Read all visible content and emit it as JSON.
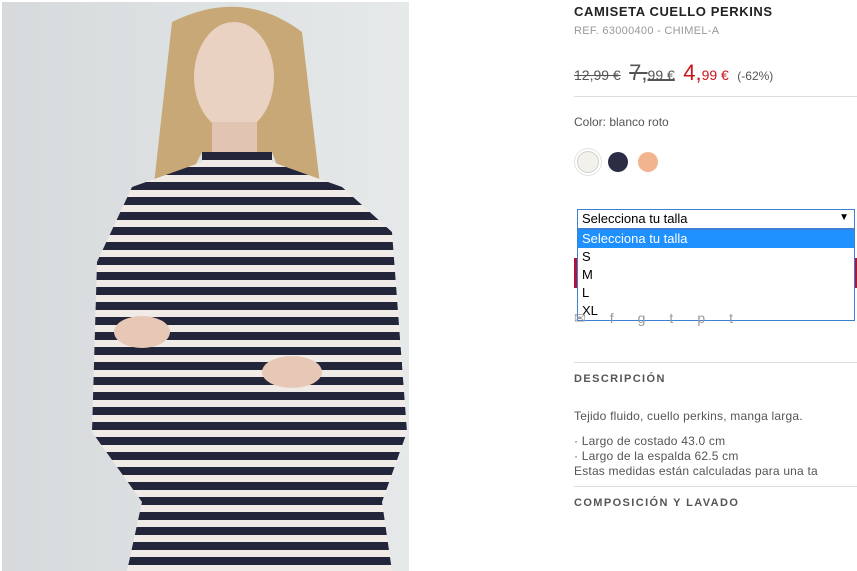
{
  "product": {
    "name": "CAMISETA CUELLO PERKINS",
    "ref": "REF. 63000400 - CHIMEL-A",
    "price_original": "12,99 €",
    "price_previous_int": "7,",
    "price_previous_dec": "99 €",
    "price_current_int": "4,",
    "price_current_dec": "99 €",
    "discount": "(-62%)",
    "color_label": "Color: blanco roto",
    "swatches": [
      {
        "name": "blanco roto",
        "hex": "#f3f1ec"
      },
      {
        "name": "marino",
        "hex": "#2b2d45"
      },
      {
        "name": "melocoton",
        "hex": "#f2b48e"
      }
    ]
  },
  "size_select": {
    "selected": "Selecciona tu talla",
    "options": [
      "Selecciona tu talla",
      "S",
      "M",
      "L",
      "XL"
    ],
    "arrow": "▼"
  },
  "share_icons": [
    "email-icon",
    "facebook-icon",
    "google-plus-icon",
    "twitter-icon",
    "pinterest-icon",
    "tumblr-icon"
  ],
  "sections": {
    "description_title": "DESCRIPCIÓN",
    "description_body": "Tejido fluido, cuello perkins, manga larga.",
    "measure1": "· Largo de costado 43.0 cm",
    "measure2": "· Largo de la espalda 62.5 cm",
    "measure_note": "Estas medidas están calculadas para una ta",
    "composition_title": "COMPOSICIÓN Y LAVADO"
  },
  "colors": {
    "accent_red": "#c8161d",
    "button_edge": "#b3123f",
    "select_blue": "#1e90ff"
  }
}
